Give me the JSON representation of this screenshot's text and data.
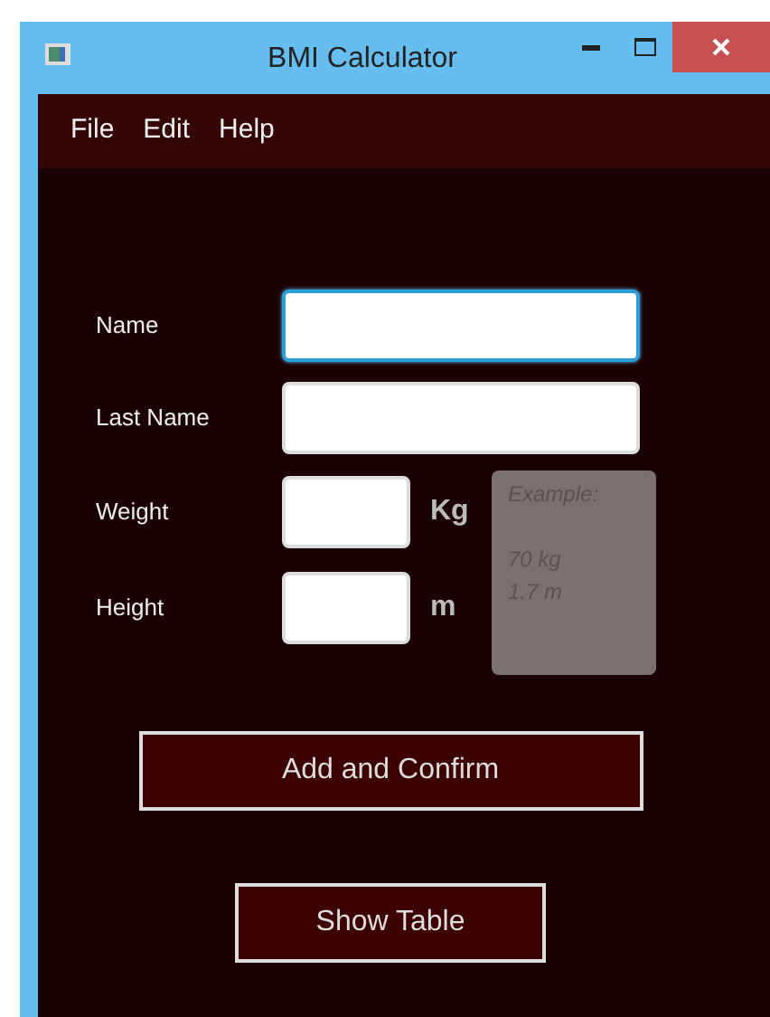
{
  "window": {
    "title": "BMI Calculator"
  },
  "menu": [
    "File",
    "Edit",
    "Help"
  ],
  "form": {
    "fields": [
      {
        "label": "Name",
        "kind": "wide",
        "focused": true
      },
      {
        "label": "Last Name",
        "kind": "wide",
        "focused": false
      },
      {
        "label": "Weight",
        "kind": "short",
        "unit": "Kg",
        "focused": false
      },
      {
        "label": "Height",
        "kind": "short",
        "unit": "m",
        "focused": false
      }
    ],
    "example": {
      "title": "Example:",
      "lines": [
        "70 kg",
        "1.7 m"
      ]
    }
  },
  "buttons": [
    "Add and Confirm",
    "Show Table"
  ]
}
